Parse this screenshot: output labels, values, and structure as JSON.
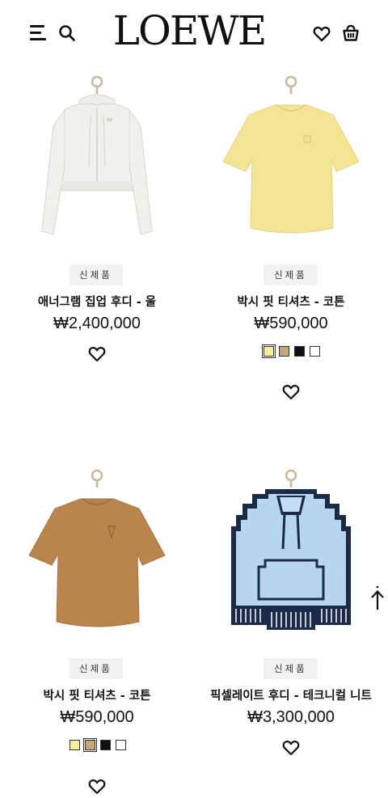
{
  "header": {
    "logo": "LOEWE",
    "menu_icon": "hamburger-menu-icon",
    "search_icon": "search-icon",
    "wishlist_icon": "heart-icon",
    "bag_icon": "shopping-bag-icon"
  },
  "products": [
    {
      "badge": "신제품",
      "name": "애너그램 집업 후디 - 울",
      "price": "₩2,400,000",
      "swatches": []
    },
    {
      "badge": "신제품",
      "name": "박시 핏 티셔츠 - 코튼",
      "price": "₩590,000",
      "swatches": [
        {
          "color": "#f5ee9a",
          "selected": true
        },
        {
          "color": "#c4a77c",
          "selected": false
        },
        {
          "color": "#111111",
          "selected": false
        },
        {
          "color": "#ffffff",
          "selected": false
        }
      ]
    },
    {
      "badge": "신제품",
      "name": "박시 핏 티셔츠 - 코튼",
      "price": "₩590,000",
      "swatches": [
        {
          "color": "#f5ee9a",
          "selected": false
        },
        {
          "color": "#c4a77c",
          "selected": true
        },
        {
          "color": "#111111",
          "selected": false
        },
        {
          "color": "#ffffff",
          "selected": false
        }
      ]
    },
    {
      "badge": "신제품",
      "name": "픽셀레이트 후디 - 테크니컬 니트",
      "price": "₩3,300,000",
      "swatches": []
    }
  ],
  "back_to_top_icon": "arrow-up-icon"
}
